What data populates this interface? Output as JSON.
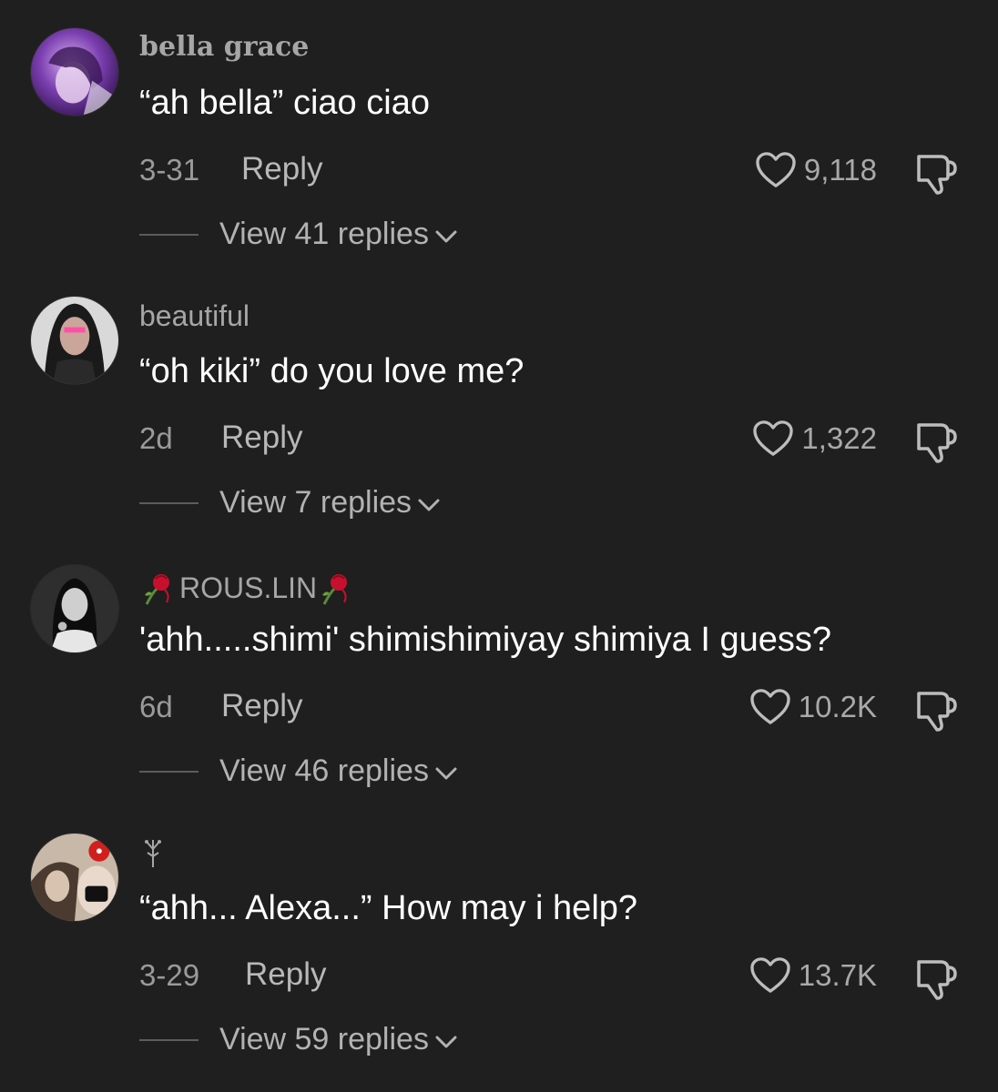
{
  "comments": [
    {
      "username": "bella grace",
      "text": "“ah bella” ciao ciao",
      "date": "3-31",
      "reply_label": "Reply",
      "likes": "9,118",
      "view_replies": "View 41 replies"
    },
    {
      "username": "beautiful",
      "text": "“oh kiki” do you love me?",
      "date": "2d",
      "reply_label": "Reply",
      "likes": "1,322",
      "view_replies": "View 7 replies"
    },
    {
      "username": "ROUS.LIN",
      "text": "'ahh.....shimi' shimishimiyay shimiya I guess?",
      "date": "6d",
      "reply_label": "Reply",
      "likes": "10.2K",
      "view_replies": "View 46 replies"
    },
    {
      "username": "",
      "text": "“ahh... Alexa...” How may i help?",
      "date": "3-29",
      "reply_label": "Reply",
      "likes": "13.7K",
      "view_replies": "View 59 replies"
    }
  ],
  "icons": {
    "like": "heart-outline-icon",
    "dislike": "thumbs-down-icon",
    "expand": "chevron-down-icon",
    "username_decoration": "rose-icon"
  },
  "colors": {
    "background": "#1f1f1f",
    "text_primary": "#ffffff",
    "text_secondary": "#a6a6a6"
  }
}
